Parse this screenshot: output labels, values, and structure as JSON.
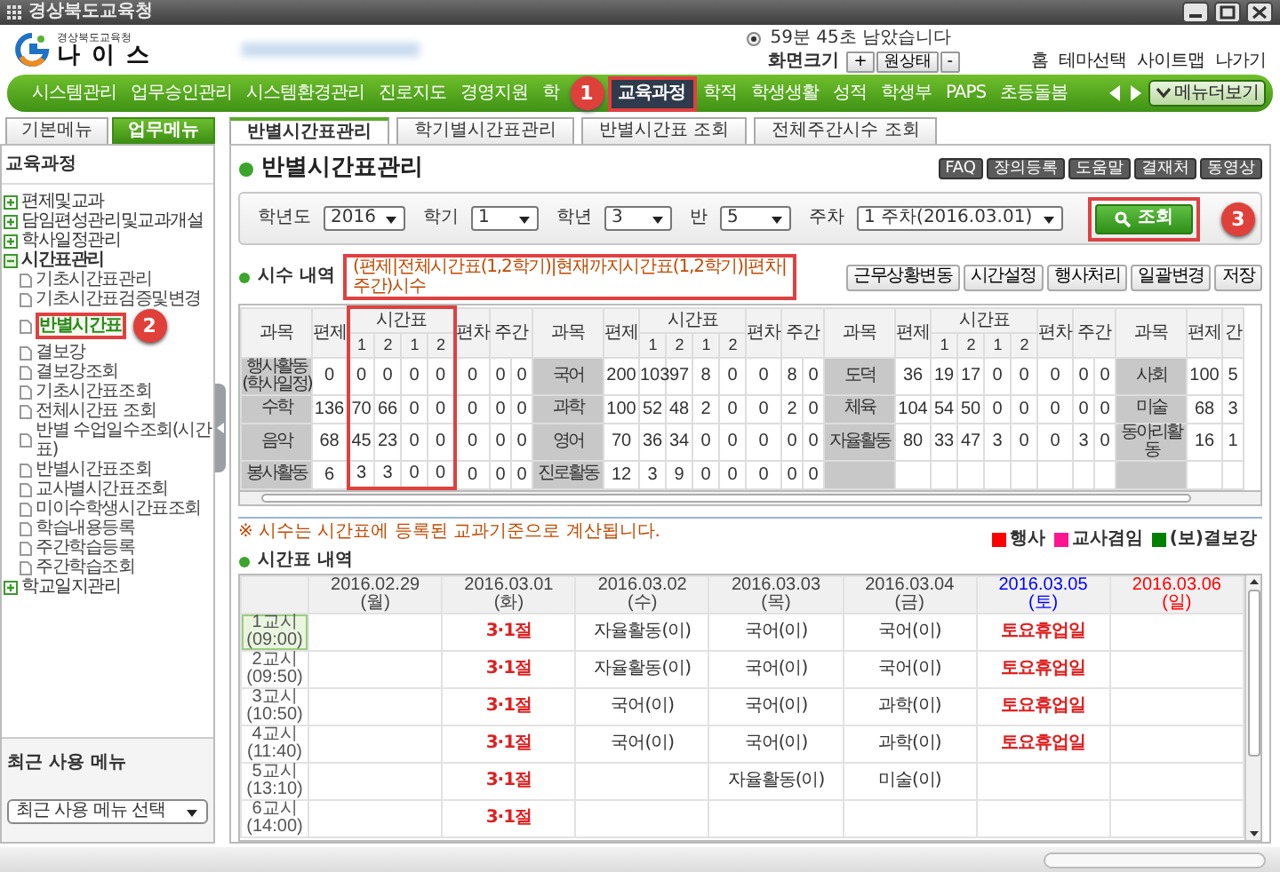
{
  "window": {
    "title": "경상북도교육청"
  },
  "header": {
    "org": "경상북도교육청",
    "logo_text": "나 이 스",
    "session": "59분 45초 남았습니다",
    "zoom_label": "화면크기",
    "zoom_buttons": [
      "+",
      "원상태",
      "-"
    ],
    "links": [
      "홈",
      "테마선택",
      "사이트맵",
      "나가기"
    ]
  },
  "main_menu": {
    "items": [
      {
        "label": "시스템관리",
        "selected": false
      },
      {
        "label": "업무승인관리",
        "selected": false
      },
      {
        "label": "시스템환경관리",
        "selected": false
      },
      {
        "label": "진로지도",
        "selected": false
      },
      {
        "label": "경영지원",
        "selected": false
      },
      {
        "label": "학",
        "selected": false
      },
      {
        "label": "교육과정",
        "selected": true
      },
      {
        "label": "학적",
        "selected": false
      },
      {
        "label": "학생생활",
        "selected": false
      },
      {
        "label": "성적",
        "selected": false
      },
      {
        "label": "학생부",
        "selected": false
      },
      {
        "label": "PAPS",
        "selected": false
      },
      {
        "label": "초등돌봄",
        "selected": false
      }
    ],
    "more_button": "메뉴더보기"
  },
  "sidebar": {
    "tabs": [
      {
        "label": "기본메뉴",
        "selected": false
      },
      {
        "label": "업무메뉴",
        "selected": true
      }
    ],
    "section": "교육과정",
    "tree": [
      {
        "label": "편제및교과",
        "expanded": false
      },
      {
        "label": "담임편성관리및교과개설",
        "expanded": false
      },
      {
        "label": "학사일정관리",
        "expanded": false
      },
      {
        "label": "시간표관리",
        "expanded": true,
        "children": [
          {
            "label": "기초시간표관리",
            "selected": false
          },
          {
            "label": "기초시간표검증및변경",
            "selected": false
          },
          {
            "label": "반별시간표",
            "selected": true
          },
          {
            "label": "결보강",
            "selected": false
          },
          {
            "label": "결보강조회",
            "selected": false
          },
          {
            "label": "기초시간표조회",
            "selected": false
          },
          {
            "label": "전체시간표 조회",
            "selected": false
          },
          {
            "label": "반별 수업일수조회(시간표)",
            "selected": false
          },
          {
            "label": "반별시간표조회",
            "selected": false
          },
          {
            "label": "교사별시간표조회",
            "selected": false
          },
          {
            "label": "미이수학생시간표조회",
            "selected": false
          },
          {
            "label": "학습내용등록",
            "selected": false
          },
          {
            "label": "주간학습등록",
            "selected": false
          },
          {
            "label": "주간학습조회",
            "selected": false
          }
        ]
      },
      {
        "label": "학교일지관리",
        "expanded": false
      }
    ],
    "recent_title": "최근 사용 메뉴",
    "recent_select": "최근 사용 메뉴 선택"
  },
  "content_tabs": [
    {
      "label": "반별시간표관리",
      "selected": true
    },
    {
      "label": "학기별시간표관리",
      "selected": false
    },
    {
      "label": "반별시간표 조회",
      "selected": false
    },
    {
      "label": "전체주간시수 조회",
      "selected": false
    }
  ],
  "page": {
    "title": "반별시간표관리",
    "tools": [
      "FAQ",
      "장의등록",
      "도움말",
      "결재처",
      "동영상"
    ]
  },
  "filters": [
    {
      "label": "학년도",
      "value": "2016"
    },
    {
      "label": "학기",
      "value": "1"
    },
    {
      "label": "학년",
      "value": "3"
    },
    {
      "label": "반",
      "value": "5"
    },
    {
      "label": "주차",
      "value": "1 주차(2016.03.01)"
    }
  ],
  "search_button": "조회",
  "summary": {
    "title": "시수 내역",
    "note": "(편제|전체시간표(1,2학기)|현재까지시간표(1,2학기)|편차|주간)시수",
    "buttons": [
      "근무상황변동",
      "시간설정",
      "행사처리",
      "일괄변경",
      "저장"
    ],
    "header_groups": [
      {
        "subject": "과목",
        "quota": "편제",
        "timetable": "시간표",
        "sub": [
          "1",
          "2",
          "1",
          "2"
        ],
        "deviation": "편차",
        "weekly": "주간"
      },
      {
        "subject": "과목",
        "quota": "편제",
        "timetable": "시간표",
        "sub": [
          "1",
          "2",
          "1",
          "2"
        ],
        "deviation": "편차",
        "weekly": "주간"
      },
      {
        "subject": "과목",
        "quota": "편제",
        "timetable": "시간표",
        "sub": [
          "1",
          "2",
          "1",
          "2"
        ],
        "deviation": "편차",
        "weekly": "주간"
      },
      {
        "subject": "과목",
        "quota": "편제",
        "timetable": "간"
      }
    ],
    "rows": [
      [
        {
          "subject": "행사활동(학사일정)",
          "values": [
            "0",
            "0",
            "0",
            "0",
            "0",
            "0",
            "0",
            "0"
          ]
        },
        {
          "subject": "국어",
          "values": [
            "200",
            "103",
            "97",
            "8",
            "0",
            "0",
            "8",
            "0"
          ]
        },
        {
          "subject": "도덕",
          "values": [
            "36",
            "19",
            "17",
            "0",
            "0",
            "0",
            "0",
            "0"
          ]
        },
        {
          "subject": "사회",
          "values": [
            "100",
            "5"
          ]
        }
      ],
      [
        {
          "subject": "수학",
          "values": [
            "136",
            "70",
            "66",
            "0",
            "0",
            "0",
            "0",
            "0"
          ]
        },
        {
          "subject": "과학",
          "values": [
            "100",
            "52",
            "48",
            "2",
            "0",
            "0",
            "2",
            "0"
          ]
        },
        {
          "subject": "체육",
          "values": [
            "104",
            "54",
            "50",
            "0",
            "0",
            "0",
            "0",
            "0"
          ]
        },
        {
          "subject": "미술",
          "values": [
            "68",
            "3"
          ]
        }
      ],
      [
        {
          "subject": "음악",
          "values": [
            "68",
            "45",
            "23",
            "0",
            "0",
            "0",
            "0",
            "0"
          ]
        },
        {
          "subject": "영어",
          "values": [
            "70",
            "36",
            "34",
            "0",
            "0",
            "0",
            "0",
            "0"
          ]
        },
        {
          "subject": "자율활동",
          "values": [
            "80",
            "33",
            "47",
            "3",
            "0",
            "0",
            "3",
            "0"
          ]
        },
        {
          "subject": "동아리활동",
          "values": [
            "16",
            "1"
          ]
        }
      ],
      [
        {
          "subject": "봉사활동",
          "values": [
            "6",
            "3",
            "3",
            "0",
            "0",
            "0",
            "0",
            "0"
          ]
        },
        {
          "subject": "진로활동",
          "values": [
            "12",
            "3",
            "9",
            "0",
            "0",
            "0",
            "0",
            "0"
          ]
        }
      ]
    ]
  },
  "footnote": "※ 시수는 시간표에 등록된 교과기준으로 계산됩니다.",
  "legend": [
    {
      "label": "행사",
      "color": "#ff0000"
    },
    {
      "label": "교사겸임",
      "color": "#ff1493"
    },
    {
      "label": "(보)결보강",
      "color": "#008000"
    }
  ],
  "timetable": {
    "title": "시간표 내역",
    "days": [
      {
        "date": "2016.02.29",
        "weekday": "(월)",
        "color": "#444444"
      },
      {
        "date": "2016.03.01",
        "weekday": "(화)",
        "color": "#444444"
      },
      {
        "date": "2016.03.02",
        "weekday": "(수)",
        "color": "#444444"
      },
      {
        "date": "2016.03.03",
        "weekday": "(목)",
        "color": "#444444"
      },
      {
        "date": "2016.03.04",
        "weekday": "(금)",
        "color": "#444444"
      },
      {
        "date": "2016.03.05",
        "weekday": "(토)",
        "color": "#0000ff"
      },
      {
        "date": "2016.03.06",
        "weekday": "(일)",
        "color": "#ff0000"
      }
    ],
    "periods": [
      {
        "name": "1교시",
        "time": "(09:00)",
        "selected": true,
        "cells": [
          null,
          {
            "text": "3·1절",
            "kind": "event"
          },
          {
            "text": "자율활동(이)",
            "kind": "class"
          },
          {
            "text": "국어(이)",
            "kind": "class"
          },
          {
            "text": "국어(이)",
            "kind": "class"
          },
          {
            "text": "토요휴업일",
            "kind": "event"
          },
          null
        ]
      },
      {
        "name": "2교시",
        "time": "(09:50)",
        "selected": false,
        "cells": [
          null,
          {
            "text": "3·1절",
            "kind": "event"
          },
          {
            "text": "자율활동(이)",
            "kind": "class"
          },
          {
            "text": "국어(이)",
            "kind": "class"
          },
          {
            "text": "국어(이)",
            "kind": "class"
          },
          {
            "text": "토요휴업일",
            "kind": "event"
          },
          null
        ]
      },
      {
        "name": "3교시",
        "time": "(10:50)",
        "selected": false,
        "cells": [
          null,
          {
            "text": "3·1절",
            "kind": "event"
          },
          {
            "text": "국어(이)",
            "kind": "class"
          },
          {
            "text": "국어(이)",
            "kind": "class"
          },
          {
            "text": "과학(이)",
            "kind": "class"
          },
          {
            "text": "토요휴업일",
            "kind": "event"
          },
          null
        ]
      },
      {
        "name": "4교시",
        "time": "(11:40)",
        "selected": false,
        "cells": [
          null,
          {
            "text": "3·1절",
            "kind": "event"
          },
          {
            "text": "국어(이)",
            "kind": "class"
          },
          {
            "text": "국어(이)",
            "kind": "class"
          },
          {
            "text": "과학(이)",
            "kind": "class"
          },
          {
            "text": "토요휴업일",
            "kind": "event"
          },
          null
        ]
      },
      {
        "name": "5교시",
        "time": "(13:10)",
        "selected": false,
        "cells": [
          null,
          {
            "text": "3·1절",
            "kind": "event"
          },
          null,
          {
            "text": "자율활동(이)",
            "kind": "class"
          },
          {
            "text": "미술(이)",
            "kind": "class"
          },
          null,
          null
        ]
      },
      {
        "name": "6교시",
        "time": "(14:00)",
        "selected": false,
        "cells": [
          null,
          {
            "text": "3·1절",
            "kind": "event"
          },
          null,
          null,
          null,
          null,
          null
        ]
      }
    ]
  },
  "annotations": [
    {
      "number": "1"
    },
    {
      "number": "2"
    },
    {
      "number": "3"
    }
  ]
}
